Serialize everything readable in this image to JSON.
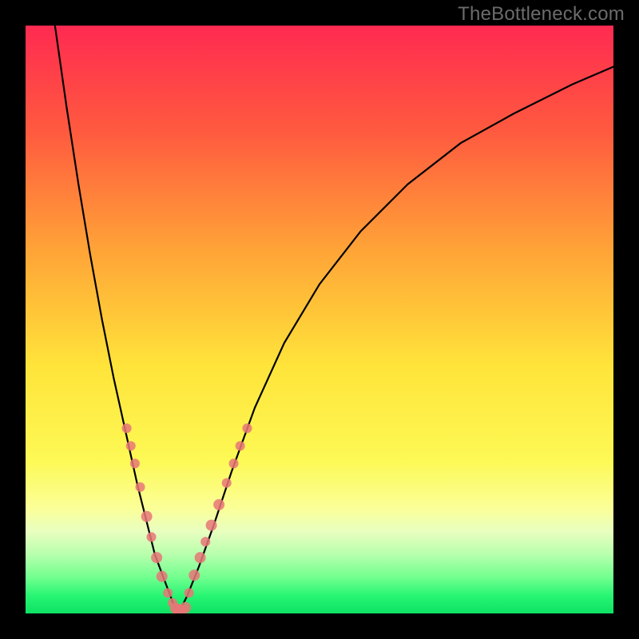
{
  "watermark": "TheBottleneck.com",
  "chart_data": {
    "type": "line",
    "title": "",
    "xlabel": "",
    "ylabel": "",
    "xlim": [
      0,
      100
    ],
    "ylim": [
      0,
      100
    ],
    "gradient_stops": [
      {
        "pct": 0,
        "color": "#ff2a51"
      },
      {
        "pct": 18,
        "color": "#ff5a3f"
      },
      {
        "pct": 38,
        "color": "#ffa337"
      },
      {
        "pct": 58,
        "color": "#ffe43a"
      },
      {
        "pct": 74,
        "color": "#fdf955"
      },
      {
        "pct": 82,
        "color": "#fbff97"
      },
      {
        "pct": 86,
        "color": "#e9ffc0"
      },
      {
        "pct": 90,
        "color": "#b6ffac"
      },
      {
        "pct": 94,
        "color": "#6fff8e"
      },
      {
        "pct": 97,
        "color": "#27f573"
      },
      {
        "pct": 100,
        "color": "#0ee264"
      }
    ],
    "series": [
      {
        "name": "left-curve",
        "x": [
          5,
          7,
          9,
          11,
          13,
          15,
          17,
          19,
          20.5,
          22,
          23.5,
          25,
          26
        ],
        "y": [
          100,
          86,
          73,
          61,
          50,
          40,
          31,
          22,
          16,
          10,
          6,
          2,
          0
        ]
      },
      {
        "name": "right-curve",
        "x": [
          26,
          27.5,
          29.5,
          32,
          35,
          39,
          44,
          50,
          57,
          65,
          74,
          83,
          93,
          100
        ],
        "y": [
          0,
          3,
          8,
          15,
          24,
          35,
          46,
          56,
          65,
          73,
          80,
          85,
          90,
          93
        ]
      }
    ],
    "marker_clusters": [
      {
        "name": "left-branch-markers",
        "color": "#e77777",
        "points": [
          {
            "x": 17.2,
            "y": 31.5,
            "r": 6
          },
          {
            "x": 17.9,
            "y": 28.5,
            "r": 6
          },
          {
            "x": 18.6,
            "y": 25.5,
            "r": 6
          },
          {
            "x": 19.5,
            "y": 21.5,
            "r": 6
          },
          {
            "x": 20.6,
            "y": 16.5,
            "r": 7
          },
          {
            "x": 21.4,
            "y": 13.0,
            "r": 6
          },
          {
            "x": 22.3,
            "y": 9.5,
            "r": 7
          },
          {
            "x": 23.2,
            "y": 6.3,
            "r": 7
          },
          {
            "x": 24.2,
            "y": 3.5,
            "r": 6
          },
          {
            "x": 25.0,
            "y": 1.8,
            "r": 6
          }
        ]
      },
      {
        "name": "valley-base-markers",
        "color": "#e77777",
        "points": [
          {
            "x": 25.5,
            "y": 0.9,
            "r": 7
          },
          {
            "x": 26.0,
            "y": 0.6,
            "r": 7
          },
          {
            "x": 26.6,
            "y": 0.6,
            "r": 7
          },
          {
            "x": 27.2,
            "y": 1.0,
            "r": 7
          }
        ]
      },
      {
        "name": "right-branch-markers",
        "color": "#e77777",
        "points": [
          {
            "x": 27.8,
            "y": 3.5,
            "r": 6
          },
          {
            "x": 28.7,
            "y": 6.5,
            "r": 7
          },
          {
            "x": 29.7,
            "y": 9.5,
            "r": 7
          },
          {
            "x": 30.6,
            "y": 12.2,
            "r": 6
          },
          {
            "x": 31.6,
            "y": 15.0,
            "r": 7
          },
          {
            "x": 32.9,
            "y": 18.5,
            "r": 7
          },
          {
            "x": 34.2,
            "y": 22.2,
            "r": 6
          },
          {
            "x": 35.4,
            "y": 25.5,
            "r": 6
          },
          {
            "x": 36.5,
            "y": 28.5,
            "r": 6
          },
          {
            "x": 37.7,
            "y": 31.5,
            "r": 6
          }
        ]
      }
    ]
  }
}
